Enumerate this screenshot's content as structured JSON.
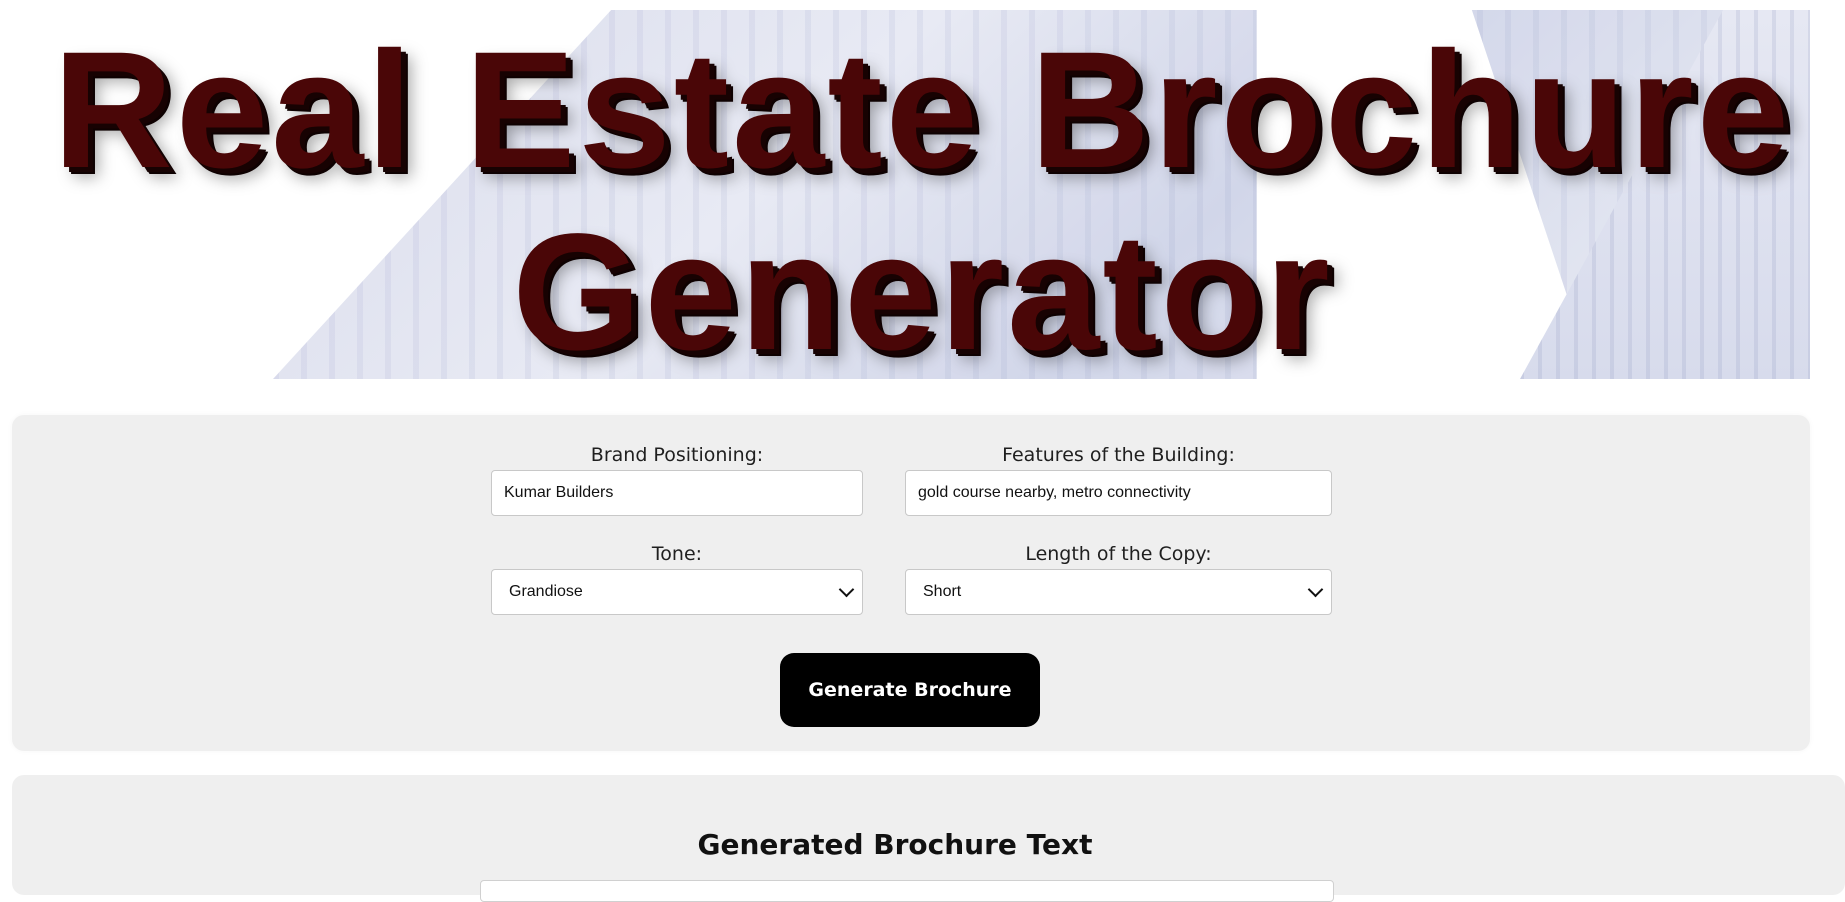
{
  "header": {
    "title_line1": "Real Estate Brochure",
    "title_line2": "Generator"
  },
  "form": {
    "brand_label": "Brand Positioning:",
    "brand_value": "Kumar Builders",
    "features_label": "Features of the Building:",
    "features_value": "gold course nearby, metro connectivity",
    "tone_label": "Tone:",
    "tone_selected": "Grandiose",
    "length_label": "Length of the Copy:",
    "length_selected": "Short",
    "submit_label": "Generate Brochure"
  },
  "output": {
    "heading": "Generated Brochure Text"
  },
  "colors": {
    "title_color": "#4a0607",
    "button_bg": "#000000",
    "card_bg": "#efefef"
  }
}
